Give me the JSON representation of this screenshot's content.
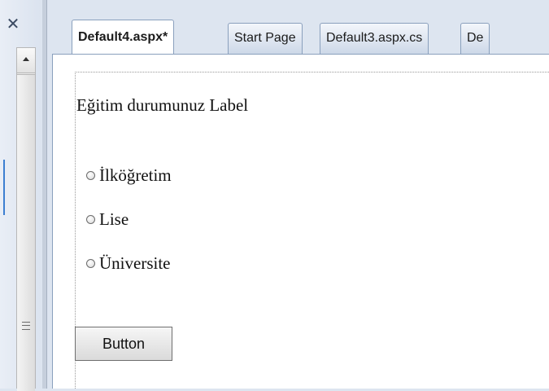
{
  "tabs": [
    {
      "label": "Default4.aspx*",
      "active": true
    },
    {
      "label": "Start Page",
      "active": false
    },
    {
      "label": "Default3.aspx.cs",
      "active": false
    },
    {
      "label": "De",
      "active": false
    }
  ],
  "design": {
    "label_text": "Eğitim durumunuz Label",
    "radio_options": [
      "İlköğretim",
      "Lise",
      "Üniversite"
    ],
    "button_label": "Button"
  },
  "icons": {
    "close": "close-icon",
    "scroll_up": "chevron-up-icon",
    "thumb_grip": "grip-icon"
  }
}
